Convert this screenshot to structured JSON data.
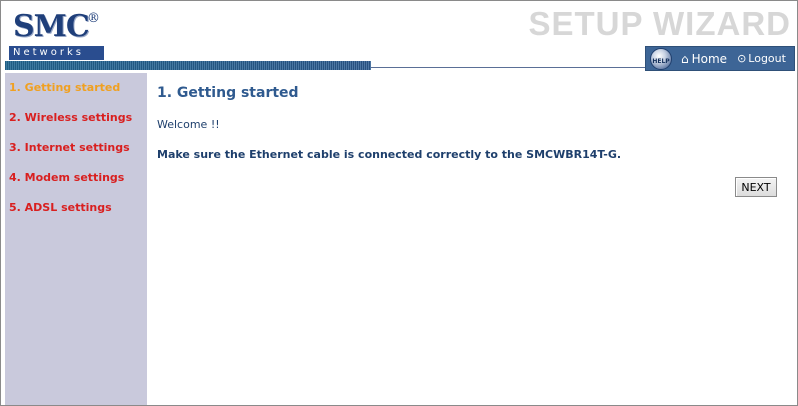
{
  "header": {
    "logo_text": "SMC",
    "logo_registered": "®",
    "logo_sub": "Networks",
    "title": "SETUP WIZARD"
  },
  "topnav": {
    "help_label": "HELP",
    "home_label": "Home",
    "logout_label": "Logout"
  },
  "sidebar": {
    "items": [
      {
        "label": "1. Getting started",
        "active": true
      },
      {
        "label": "2. Wireless settings",
        "active": false
      },
      {
        "label": "3. Internet settings",
        "active": false
      },
      {
        "label": "4. Modem settings",
        "active": false
      },
      {
        "label": "5. ADSL settings",
        "active": false
      }
    ]
  },
  "main": {
    "title": "1. Getting started",
    "welcome": "Welcome !!",
    "instruction": "Make sure the Ethernet cable is connected correctly to the SMCWBR14T-G.",
    "next_label": "NEXT"
  },
  "colors": {
    "active_item": "#f0a020",
    "inactive_item": "#d91f1f",
    "sidebar_bg": "#c9c9dc",
    "title": "#2f5a8f"
  }
}
